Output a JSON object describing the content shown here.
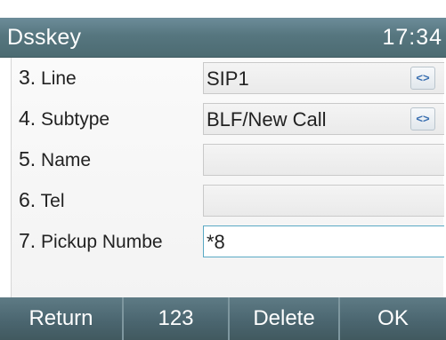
{
  "header": {
    "title": "Dsskey",
    "time": "17:34"
  },
  "rows": [
    {
      "number": "3.",
      "label": "Line",
      "value": "SIP1",
      "has_arrows": true
    },
    {
      "number": "4.",
      "label": "Subtype",
      "value": "BLF/New Call",
      "has_arrows": true
    },
    {
      "number": "5.",
      "label": "Name",
      "value": "",
      "has_arrows": false
    },
    {
      "number": "6.",
      "label": "Tel",
      "value": "",
      "has_arrows": false
    },
    {
      "number": "7.",
      "label": "Pickup Numbe",
      "value": "*8",
      "has_arrows": false,
      "selected": true
    }
  ],
  "softkeys": [
    "Return",
    "123",
    "Delete",
    "OK"
  ],
  "arrow_glyph": "<>",
  "colors": {
    "accent": "#5aa9c4",
    "titlebar": "#56767f",
    "arrow": "#3a6fb0"
  }
}
